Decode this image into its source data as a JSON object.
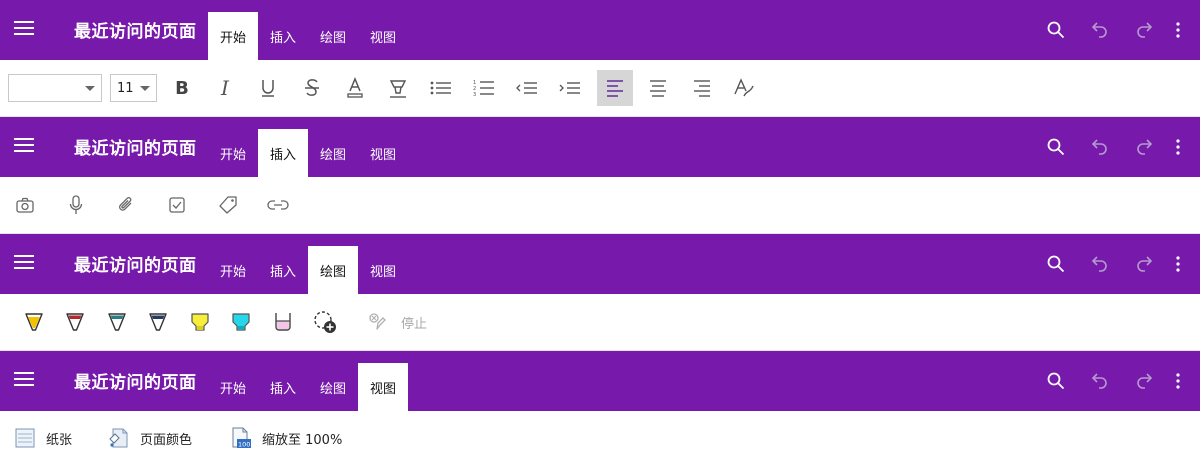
{
  "app_title": "最近访问的页面",
  "tabs": [
    "开始",
    "插入",
    "绘图",
    "视图"
  ],
  "home": {
    "font_name": "",
    "font_size": "11",
    "tools": [
      "bold-icon",
      "italic-icon",
      "underline-icon",
      "strikethrough-icon",
      "font-color-icon",
      "highlight-icon",
      "bullets-icon",
      "numbering-icon",
      "decrease-indent-icon",
      "increase-indent-icon",
      "align-left-icon",
      "align-center-icon",
      "align-right-icon",
      "clear-formatting-icon"
    ],
    "active_tool": "align-left-icon"
  },
  "insert": {
    "tools": [
      "camera-icon",
      "microphone-icon",
      "attachment-icon",
      "todo-checkbox-icon",
      "tag-icon",
      "link-icon"
    ]
  },
  "draw": {
    "pens": [
      {
        "name": "pen-yellow-tip",
        "color": "#f2c200"
      },
      {
        "name": "pen-red",
        "color": "#b22a2a"
      },
      {
        "name": "pen-teal",
        "color": "#2a7d86"
      },
      {
        "name": "pen-navy",
        "color": "#283a64"
      },
      {
        "name": "highlighter-yellow",
        "color": "#f7ee3c"
      },
      {
        "name": "highlighter-cyan",
        "color": "#26d6ea"
      },
      {
        "name": "highlighter-pink",
        "color": "#f3c6e8"
      }
    ],
    "stop_label": "停止"
  },
  "view": {
    "paper_label": "纸张",
    "page_color_label": "页面颜色",
    "zoom_label": "缩放至 100%"
  },
  "colors": {
    "brand": "#7719aa",
    "active_tool_bg": "#d6d6d6",
    "disabled": "#b59ad0"
  }
}
